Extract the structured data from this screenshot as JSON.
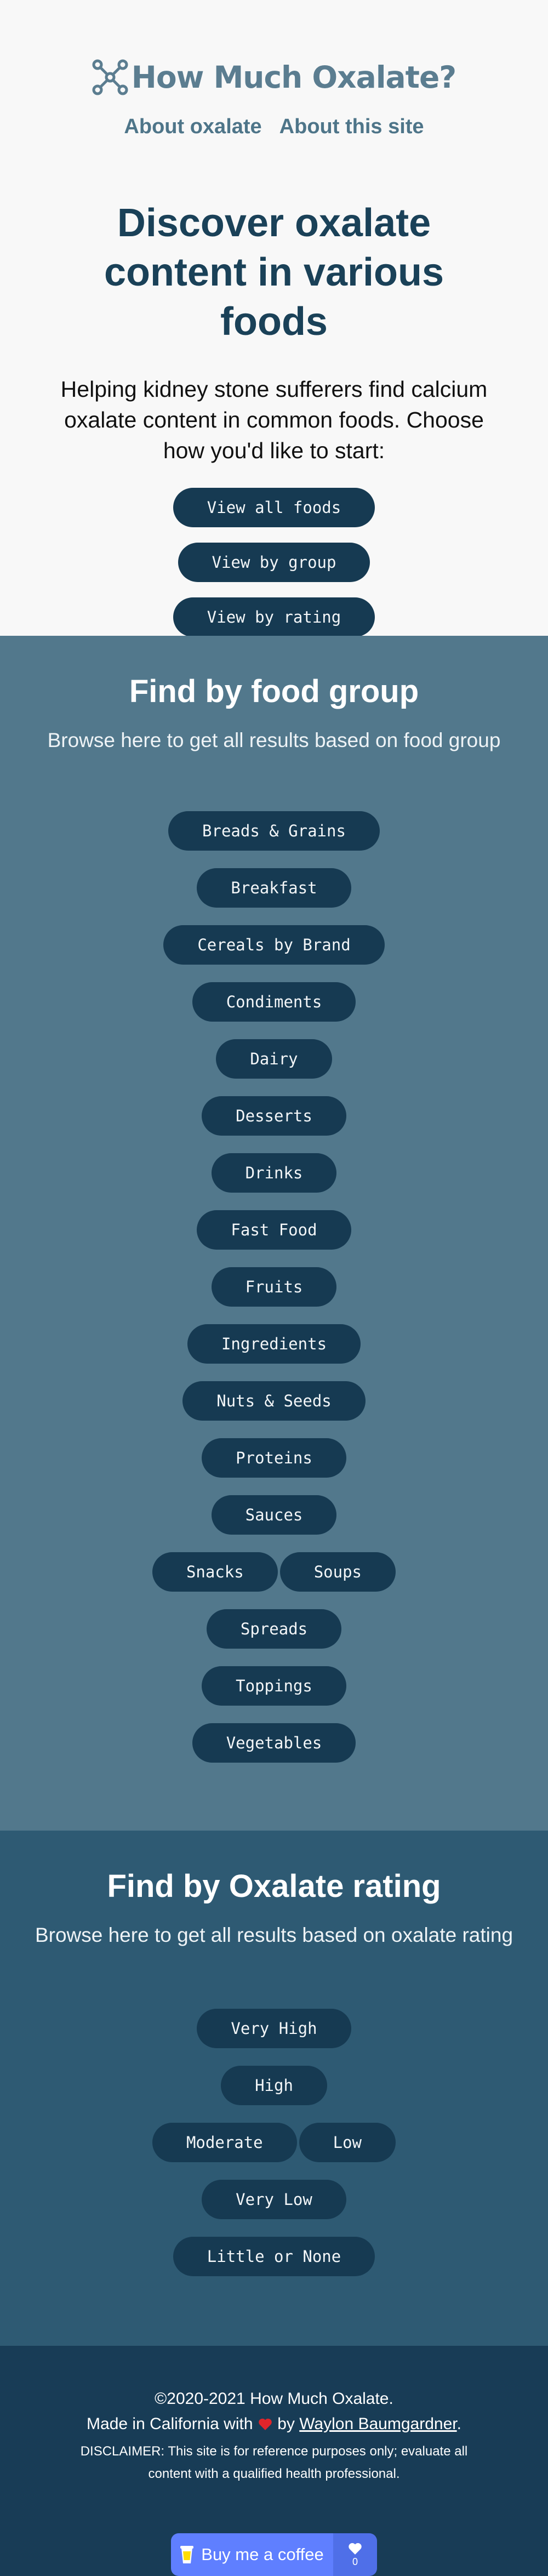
{
  "header": {
    "logo_text": "How Much Oxalate?",
    "nav": [
      "About oxalate",
      "About this site"
    ]
  },
  "hero": {
    "title": "Discover oxalate content in various foods",
    "lead": "Helping kidney stone sufferers find calcium oxalate content in common foods. Choose how you'd like to start:",
    "buttons": [
      "View all foods",
      "View by group",
      "View by rating"
    ]
  },
  "groups": {
    "title": "Find by food group",
    "subtitle": "Browse here to get all results based on food group",
    "items": [
      "Breads & Grains",
      "Breakfast",
      "Cereals by Brand",
      "Condiments",
      "Dairy",
      "Desserts",
      "Drinks",
      "Fast Food",
      "Fruits",
      "Ingredients",
      "Nuts & Seeds",
      "Proteins",
      "Sauces",
      "Snacks",
      "Soups",
      "Spreads",
      "Toppings",
      "Vegetables"
    ]
  },
  "ratings": {
    "title": "Find by Oxalate rating",
    "subtitle": "Browse here to get all results based on oxalate rating",
    "items": [
      "Very High",
      "High",
      "Moderate",
      "Low",
      "Very Low",
      "Little or None"
    ]
  },
  "footer": {
    "copyright": "©2020-2021 How Much Oxalate.",
    "made_prefix": "Made in California with",
    "made_by": "by",
    "author": "Waylon Baumgardner",
    "period": ".",
    "disclaimer": "DISCLAIMER: This site is for reference purposes only; evaluate all content with a qualified health professional.",
    "coffee_label": "Buy me a coffee",
    "coffee_count": "0"
  },
  "colors": {
    "logo": "#5b7d90",
    "heading": "#1a4158",
    "pill": "#163a52",
    "groups_bg": "#52788c",
    "ratings_bg": "#2e5a73",
    "footer_bg": "#183c56",
    "coffee": "#5f7fff"
  },
  "icons": [
    "molecule-logo-icon",
    "heart-icon",
    "coffee-cup-icon",
    "heart-icon"
  ]
}
